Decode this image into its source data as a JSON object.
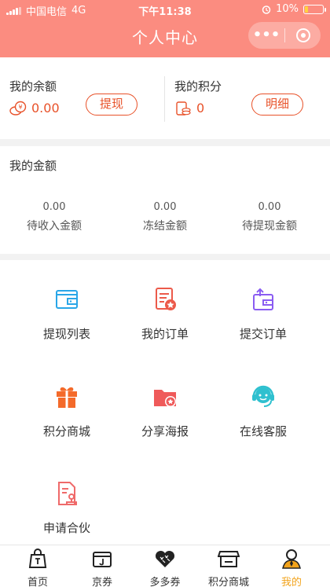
{
  "status": {
    "carrier": "中国电信",
    "network": "4G",
    "time": "下午11:38",
    "battery": "10%"
  },
  "header": {
    "title": "个人中心"
  },
  "balance": {
    "label": "我的余额",
    "value": "0.00",
    "button": "提现"
  },
  "points": {
    "label": "我的积分",
    "value": "0",
    "button": "明细"
  },
  "amounts": {
    "title": "我的金额",
    "items": [
      {
        "value": "0.00",
        "label": "待收入金额"
      },
      {
        "value": "0.00",
        "label": "冻结金额"
      },
      {
        "value": "0.00",
        "label": "待提现金额"
      }
    ]
  },
  "menu": {
    "items": [
      {
        "label": "提现列表",
        "icon": "wallet-icon"
      },
      {
        "label": "我的订单",
        "icon": "order-icon"
      },
      {
        "label": "提交订单",
        "icon": "submit-order-icon"
      },
      {
        "label": "积分商城",
        "icon": "gift-icon"
      },
      {
        "label": "分享海报",
        "icon": "folder-star-icon"
      },
      {
        "label": "在线客服",
        "icon": "customer-service-icon"
      },
      {
        "label": "申请合伙",
        "icon": "apply-document-icon"
      }
    ]
  },
  "tabbar": {
    "items": [
      {
        "label": "首页",
        "icon": "home-bag-icon"
      },
      {
        "label": "京券",
        "icon": "jd-coupon-icon"
      },
      {
        "label": "多多券",
        "icon": "heart-coupon-icon"
      },
      {
        "label": "积分商城",
        "icon": "store-icon"
      },
      {
        "label": "我的",
        "icon": "user-icon",
        "active": true
      }
    ]
  },
  "colors": {
    "header": "#fb8c80",
    "accent": "#e8522a",
    "active_tab": "#f2a31b"
  }
}
